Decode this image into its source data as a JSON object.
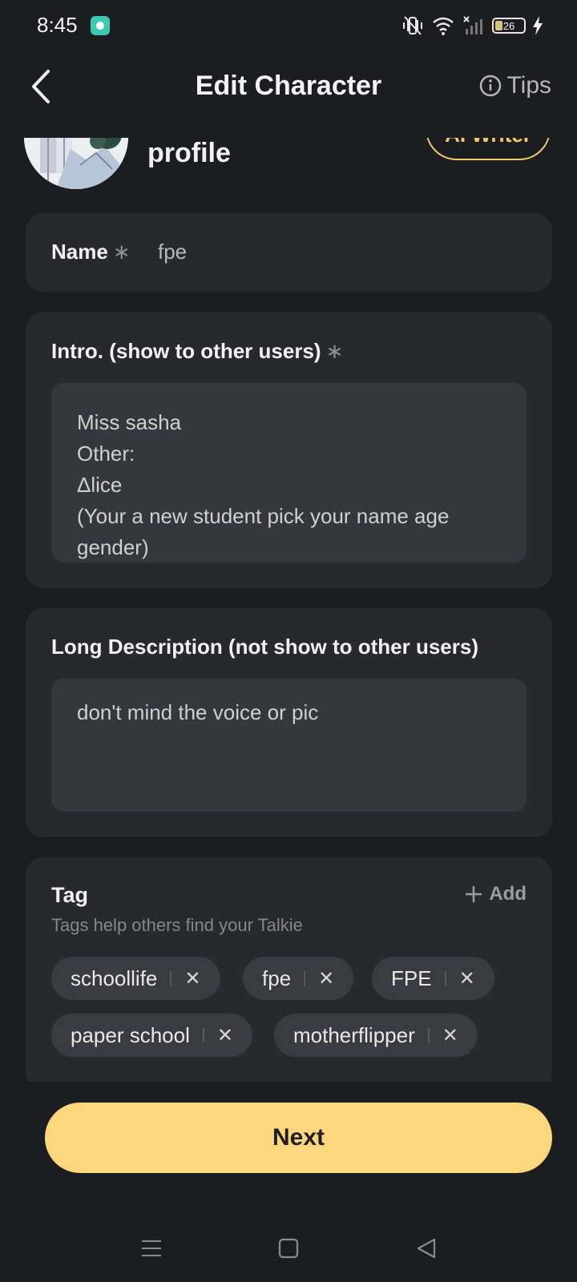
{
  "status_bar": {
    "time": "8:45",
    "battery": "26"
  },
  "header": {
    "title": "Edit Character",
    "tips_label": "Tips"
  },
  "profile": {
    "label": "profile",
    "ai_writer_label": "AI Writer"
  },
  "name_field": {
    "label": "Name",
    "required_mark": "∗",
    "value": "fpe"
  },
  "intro_field": {
    "label": "Intro. (show to other users)",
    "required_mark": "∗",
    "lines": [
      "Miss sasha",
      "Other:",
      "Δlice",
      "(Your a new student pick your name age",
      "gender)"
    ]
  },
  "description_field": {
    "label": "Long Description (not show to other users)",
    "value": "don't mind the voice or pic"
  },
  "tags": {
    "title": "Tag",
    "add_label": "Add",
    "hint": "Tags help others find your Talkie",
    "items": [
      "schoollife",
      "fpe",
      "FPE",
      "paper school",
      "motherflipper"
    ]
  },
  "next_label": "Next",
  "colors": {
    "background": "#1c1d20",
    "card": "#28292d",
    "accent": "#fdd77e"
  }
}
